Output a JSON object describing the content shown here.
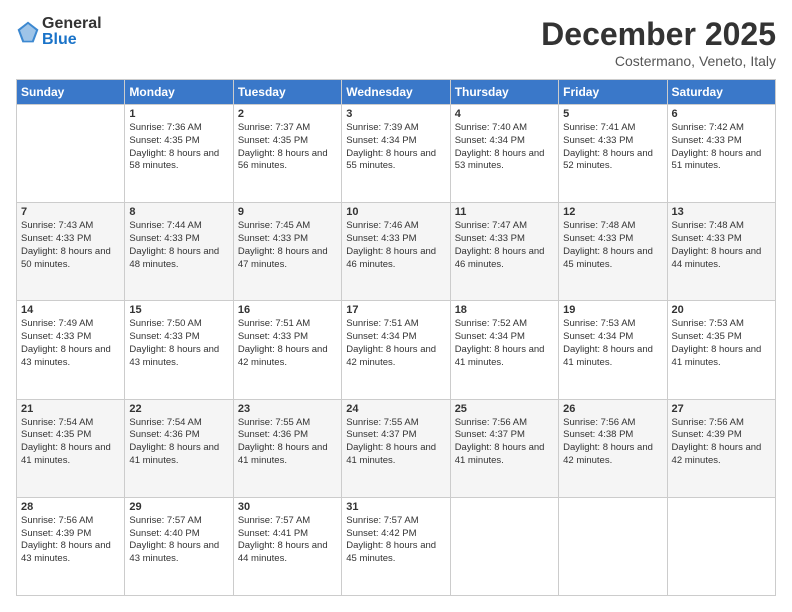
{
  "logo": {
    "general": "General",
    "blue": "Blue"
  },
  "title": {
    "month": "December 2025",
    "location": "Costermano, Veneto, Italy"
  },
  "days": [
    "Sunday",
    "Monday",
    "Tuesday",
    "Wednesday",
    "Thursday",
    "Friday",
    "Saturday"
  ],
  "weeks": [
    [
      {
        "day": "",
        "sunrise": "",
        "sunset": "",
        "daylight": ""
      },
      {
        "day": "1",
        "sunrise": "Sunrise: 7:36 AM",
        "sunset": "Sunset: 4:35 PM",
        "daylight": "Daylight: 8 hours and 58 minutes."
      },
      {
        "day": "2",
        "sunrise": "Sunrise: 7:37 AM",
        "sunset": "Sunset: 4:35 PM",
        "daylight": "Daylight: 8 hours and 56 minutes."
      },
      {
        "day": "3",
        "sunrise": "Sunrise: 7:39 AM",
        "sunset": "Sunset: 4:34 PM",
        "daylight": "Daylight: 8 hours and 55 minutes."
      },
      {
        "day": "4",
        "sunrise": "Sunrise: 7:40 AM",
        "sunset": "Sunset: 4:34 PM",
        "daylight": "Daylight: 8 hours and 53 minutes."
      },
      {
        "day": "5",
        "sunrise": "Sunrise: 7:41 AM",
        "sunset": "Sunset: 4:33 PM",
        "daylight": "Daylight: 8 hours and 52 minutes."
      },
      {
        "day": "6",
        "sunrise": "Sunrise: 7:42 AM",
        "sunset": "Sunset: 4:33 PM",
        "daylight": "Daylight: 8 hours and 51 minutes."
      }
    ],
    [
      {
        "day": "7",
        "sunrise": "Sunrise: 7:43 AM",
        "sunset": "Sunset: 4:33 PM",
        "daylight": "Daylight: 8 hours and 50 minutes."
      },
      {
        "day": "8",
        "sunrise": "Sunrise: 7:44 AM",
        "sunset": "Sunset: 4:33 PM",
        "daylight": "Daylight: 8 hours and 48 minutes."
      },
      {
        "day": "9",
        "sunrise": "Sunrise: 7:45 AM",
        "sunset": "Sunset: 4:33 PM",
        "daylight": "Daylight: 8 hours and 47 minutes."
      },
      {
        "day": "10",
        "sunrise": "Sunrise: 7:46 AM",
        "sunset": "Sunset: 4:33 PM",
        "daylight": "Daylight: 8 hours and 46 minutes."
      },
      {
        "day": "11",
        "sunrise": "Sunrise: 7:47 AM",
        "sunset": "Sunset: 4:33 PM",
        "daylight": "Daylight: 8 hours and 46 minutes."
      },
      {
        "day": "12",
        "sunrise": "Sunrise: 7:48 AM",
        "sunset": "Sunset: 4:33 PM",
        "daylight": "Daylight: 8 hours and 45 minutes."
      },
      {
        "day": "13",
        "sunrise": "Sunrise: 7:48 AM",
        "sunset": "Sunset: 4:33 PM",
        "daylight": "Daylight: 8 hours and 44 minutes."
      }
    ],
    [
      {
        "day": "14",
        "sunrise": "Sunrise: 7:49 AM",
        "sunset": "Sunset: 4:33 PM",
        "daylight": "Daylight: 8 hours and 43 minutes."
      },
      {
        "day": "15",
        "sunrise": "Sunrise: 7:50 AM",
        "sunset": "Sunset: 4:33 PM",
        "daylight": "Daylight: 8 hours and 43 minutes."
      },
      {
        "day": "16",
        "sunrise": "Sunrise: 7:51 AM",
        "sunset": "Sunset: 4:33 PM",
        "daylight": "Daylight: 8 hours and 42 minutes."
      },
      {
        "day": "17",
        "sunrise": "Sunrise: 7:51 AM",
        "sunset": "Sunset: 4:34 PM",
        "daylight": "Daylight: 8 hours and 42 minutes."
      },
      {
        "day": "18",
        "sunrise": "Sunrise: 7:52 AM",
        "sunset": "Sunset: 4:34 PM",
        "daylight": "Daylight: 8 hours and 41 minutes."
      },
      {
        "day": "19",
        "sunrise": "Sunrise: 7:53 AM",
        "sunset": "Sunset: 4:34 PM",
        "daylight": "Daylight: 8 hours and 41 minutes."
      },
      {
        "day": "20",
        "sunrise": "Sunrise: 7:53 AM",
        "sunset": "Sunset: 4:35 PM",
        "daylight": "Daylight: 8 hours and 41 minutes."
      }
    ],
    [
      {
        "day": "21",
        "sunrise": "Sunrise: 7:54 AM",
        "sunset": "Sunset: 4:35 PM",
        "daylight": "Daylight: 8 hours and 41 minutes."
      },
      {
        "day": "22",
        "sunrise": "Sunrise: 7:54 AM",
        "sunset": "Sunset: 4:36 PM",
        "daylight": "Daylight: 8 hours and 41 minutes."
      },
      {
        "day": "23",
        "sunrise": "Sunrise: 7:55 AM",
        "sunset": "Sunset: 4:36 PM",
        "daylight": "Daylight: 8 hours and 41 minutes."
      },
      {
        "day": "24",
        "sunrise": "Sunrise: 7:55 AM",
        "sunset": "Sunset: 4:37 PM",
        "daylight": "Daylight: 8 hours and 41 minutes."
      },
      {
        "day": "25",
        "sunrise": "Sunrise: 7:56 AM",
        "sunset": "Sunset: 4:37 PM",
        "daylight": "Daylight: 8 hours and 41 minutes."
      },
      {
        "day": "26",
        "sunrise": "Sunrise: 7:56 AM",
        "sunset": "Sunset: 4:38 PM",
        "daylight": "Daylight: 8 hours and 42 minutes."
      },
      {
        "day": "27",
        "sunrise": "Sunrise: 7:56 AM",
        "sunset": "Sunset: 4:39 PM",
        "daylight": "Daylight: 8 hours and 42 minutes."
      }
    ],
    [
      {
        "day": "28",
        "sunrise": "Sunrise: 7:56 AM",
        "sunset": "Sunset: 4:39 PM",
        "daylight": "Daylight: 8 hours and 43 minutes."
      },
      {
        "day": "29",
        "sunrise": "Sunrise: 7:57 AM",
        "sunset": "Sunset: 4:40 PM",
        "daylight": "Daylight: 8 hours and 43 minutes."
      },
      {
        "day": "30",
        "sunrise": "Sunrise: 7:57 AM",
        "sunset": "Sunset: 4:41 PM",
        "daylight": "Daylight: 8 hours and 44 minutes."
      },
      {
        "day": "31",
        "sunrise": "Sunrise: 7:57 AM",
        "sunset": "Sunset: 4:42 PM",
        "daylight": "Daylight: 8 hours and 45 minutes."
      },
      {
        "day": "",
        "sunrise": "",
        "sunset": "",
        "daylight": ""
      },
      {
        "day": "",
        "sunrise": "",
        "sunset": "",
        "daylight": ""
      },
      {
        "day": "",
        "sunrise": "",
        "sunset": "",
        "daylight": ""
      }
    ]
  ]
}
